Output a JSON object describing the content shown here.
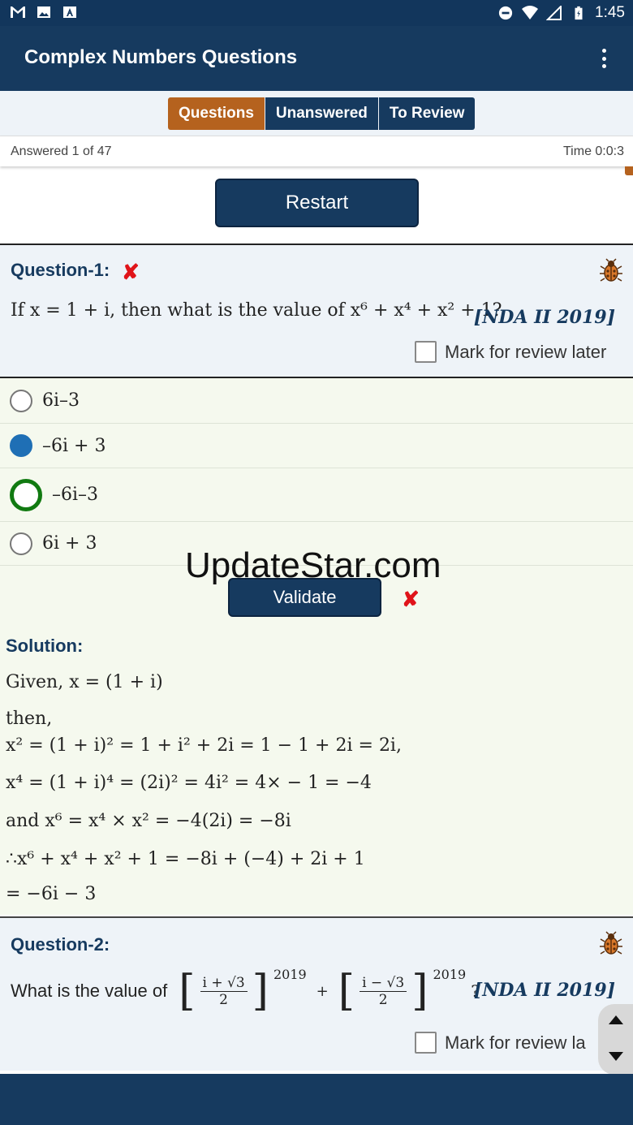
{
  "status_bar": {
    "time": "1:45",
    "icons": [
      "gmail-icon",
      "image-icon",
      "a-icon",
      "dnd-icon",
      "wifi-icon",
      "signal-icon",
      "battery-icon"
    ]
  },
  "app_bar": {
    "title": "Complex Numbers Questions",
    "menu_icon": "overflow-menu-icon"
  },
  "tabs": [
    {
      "label": "Questions",
      "active": true
    },
    {
      "label": "Unanswered",
      "active": false
    },
    {
      "label": "To Review",
      "active": false
    }
  ],
  "info": {
    "answered": "Answered 1 of 47",
    "time": "Time 0:0:3"
  },
  "restart": {
    "label": "Restart"
  },
  "question1": {
    "heading": "Question-1:",
    "text": "If x = 1 + i, then what is the value of x⁶ + x⁴ + x² + 1?",
    "source": "[NDA II 2019]",
    "review_label": "Mark for review later",
    "options": [
      {
        "text": "6i–3",
        "state": "empty"
      },
      {
        "text": "–6i + 3",
        "state": "selected"
      },
      {
        "text": "–6i–3",
        "state": "correct"
      },
      {
        "text": "6i + 3",
        "state": "empty"
      }
    ]
  },
  "watermark": "UpdateStar.com",
  "validate": {
    "label": "Validate"
  },
  "solution": {
    "title": "Solution:",
    "lines": [
      "Given, x = (1 + i)",
      "then,",
      "x² = (1 + i)² = 1 + i² + 2i = 1 − 1 + 2i = 2i,",
      "x⁴ = (1 + i)⁴ = (2i)² = 4i² = 4× − 1 = −4",
      "and x⁶ = x⁴ × x² = −4(2i) = −8i",
      "∴x⁶ + x⁴ + x² + 1 = −8i + (−4) + 2i + 1",
      " = −6i − 3"
    ]
  },
  "question2": {
    "heading": "Question-2:",
    "prefix": "What is the value of",
    "frac1_num": "i + √3",
    "frac1_den": "2",
    "frac2_num": "i − √3",
    "frac2_den": "2",
    "exponent": "2019",
    "plus": "+",
    "suffix": "?",
    "source": "[NDA II 2019]",
    "review_label": "Mark for review la"
  },
  "colors": {
    "primary": "#163a5f",
    "accent": "#b5621e",
    "wrong": "#e0141a",
    "correct": "#117a11",
    "selected": "#1f6fb5"
  }
}
